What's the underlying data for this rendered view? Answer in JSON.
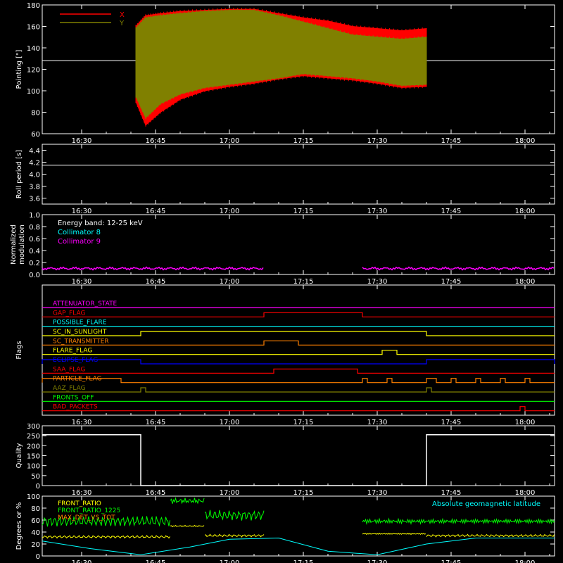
{
  "time_ticks": [
    "16:30",
    "16:45",
    "17:00",
    "17:15",
    "17:30",
    "17:45",
    "18:00"
  ],
  "chart_data": [
    {
      "type": "line",
      "ylabel": "Pointing [\"]",
      "ylim": [
        60,
        180
      ],
      "yticks": [
        60,
        80,
        100,
        120,
        140,
        160,
        180
      ],
      "xlim": [
        "16:22",
        "18:06"
      ],
      "legend": "top-left",
      "series": [
        {
          "name": "X",
          "color": "#ff0000",
          "envelope_time": [
            "16:41",
            "16:43",
            "16:46",
            "16:50",
            "16:55",
            "17:00",
            "17:05",
            "17:10",
            "17:15",
            "17:20",
            "17:25",
            "17:30",
            "17:35",
            "17:40"
          ],
          "upper": [
            160,
            170,
            172,
            174,
            175,
            176,
            176,
            172,
            168,
            165,
            160,
            158,
            156,
            158
          ],
          "lower": [
            90,
            68,
            80,
            92,
            100,
            104,
            107,
            111,
            114,
            112,
            110,
            107,
            103,
            104
          ]
        },
        {
          "name": "Y",
          "color": "#808000",
          "envelope_time": [
            "16:41",
            "16:43",
            "16:46",
            "16:50",
            "16:55",
            "17:00",
            "17:05",
            "17:10",
            "17:15",
            "17:20",
            "17:25",
            "17:30",
            "17:35",
            "17:40"
          ],
          "upper": [
            158,
            168,
            170,
            172,
            174,
            175,
            175,
            170,
            164,
            158,
            152,
            150,
            148,
            150
          ],
          "lower": [
            95,
            75,
            88,
            97,
            103,
            106,
            109,
            112,
            116,
            114,
            112,
            109,
            105,
            106
          ]
        }
      ],
      "reference_line": 128
    },
    {
      "type": "line",
      "ylabel": "Roll period [s]",
      "ylim": [
        3.5,
        4.5
      ],
      "yticks": [
        3.6,
        3.8,
        4.0,
        4.2,
        4.4
      ],
      "series": [
        {
          "color": "#ffffff",
          "value": 4.15
        }
      ]
    },
    {
      "type": "line",
      "ylabel": "Normalized modulation",
      "ylim": [
        0,
        1
      ],
      "yticks": [
        0.0,
        0.2,
        0.4,
        0.6,
        0.8,
        1.0
      ],
      "annotation": "Energy band: 12-25 keV",
      "series": [
        {
          "name": "Collimator 8",
          "color": "#00ffff",
          "segments": []
        },
        {
          "name": "Collimator 9",
          "color": "#ff00ff",
          "segments": [
            [
              "16:22",
              "17:07",
              0.1
            ],
            [
              "17:27",
              "18:06",
              0.1
            ]
          ]
        }
      ]
    },
    {
      "type": "line",
      "ylabel": "Flags",
      "flags": [
        {
          "name": "ATTENUATOR_STATE",
          "color": "#ff00ff",
          "on": []
        },
        {
          "name": "GAP_FLAG",
          "color": "#ff0000",
          "on": [
            [
              "17:07",
              "17:27"
            ]
          ]
        },
        {
          "name": "POSSIBLE_FLARE",
          "color": "#00ffff",
          "on": []
        },
        {
          "name": "SC_IN_SUNLIGHT",
          "color": "#ffff00",
          "on": [
            [
              "16:42",
              "17:40"
            ]
          ]
        },
        {
          "name": "SC_TRANSMITTER",
          "color": "#ff8000",
          "on": [
            [
              "17:07",
              "17:14"
            ]
          ]
        },
        {
          "name": "FLARE_FLAG",
          "color": "#ffff00",
          "on": [
            [
              "17:31",
              "17:34"
            ]
          ]
        },
        {
          "name": "ECLIPSE_FLAG",
          "color": "#0000ff",
          "on": [
            [
              "16:22",
              "16:42"
            ],
            [
              "17:40",
              "18:06"
            ]
          ]
        },
        {
          "name": "SAA_FLAG",
          "color": "#ff0000",
          "on": [
            [
              "17:09",
              "17:26"
            ]
          ]
        },
        {
          "name": "PARTICLE_FLAG",
          "color": "#ff8000",
          "on": [
            [
              "16:22",
              "16:38"
            ],
            [
              "17:27",
              "17:28"
            ],
            [
              "17:32",
              "17:33"
            ],
            [
              "17:40",
              "17:42"
            ],
            [
              "17:45",
              "17:46"
            ],
            [
              "17:50",
              "17:51"
            ],
            [
              "17:55",
              "17:56"
            ],
            [
              "18:00",
              "18:01"
            ]
          ]
        },
        {
          "name": "AAZ_FLAG",
          "color": "#808000",
          "on": [
            [
              "16:42",
              "16:43"
            ],
            [
              "17:40",
              "17:41"
            ]
          ]
        },
        {
          "name": "FRONTS_OFF",
          "color": "#00ff00",
          "on": []
        },
        {
          "name": "BAD_PACKETS",
          "color": "#ff0000",
          "on": [
            [
              "17:59",
              "17:60"
            ]
          ]
        }
      ]
    },
    {
      "type": "line",
      "ylabel": "Quality",
      "ylim": [
        0,
        300
      ],
      "yticks": [
        0,
        50,
        100,
        150,
        200,
        250,
        300
      ],
      "series": [
        {
          "color": "#ffffff",
          "steps": [
            [
              "16:22",
              255
            ],
            [
              "16:42",
              0
            ],
            [
              "17:40",
              255
            ],
            [
              "18:06",
              255
            ]
          ]
        }
      ]
    },
    {
      "type": "line",
      "ylabel": "Degrees or %",
      "ylim": [
        0,
        100
      ],
      "yticks": [
        0,
        20,
        40,
        60,
        80,
        100
      ],
      "legend": "top-left",
      "series": [
        {
          "name": "FRONT_RATIO",
          "color": "#ffff00",
          "segments": [
            [
              "16:22",
              "16:48",
              32
            ],
            [
              "16:48",
              "16:55",
              50
            ],
            [
              "16:55",
              "17:07",
              34
            ],
            [
              "17:27",
              "17:40",
              37
            ],
            [
              "17:40",
              "18:06",
              34
            ]
          ]
        },
        {
          "name": "FRONT_RATIO_1225",
          "color": "#00ff00",
          "segments": [
            [
              "16:22",
              "16:48",
              58
            ],
            [
              "16:48",
              "16:55",
              92
            ],
            [
              "16:55",
              "17:07",
              68
            ],
            [
              "17:27",
              "18:06",
              58
            ]
          ]
        },
        {
          "name": "MAX_DET_VS_TOT",
          "color": "#ff8000",
          "segments": []
        },
        {
          "name": "Absolute geomagnetic latitude",
          "color": "#00ffff",
          "curve_time": [
            "16:22",
            "16:32",
            "16:42",
            "16:52",
            "17:00",
            "17:10",
            "17:20",
            "17:30",
            "17:40",
            "17:50",
            "18:06"
          ],
          "curve_value": [
            25,
            12,
            2,
            15,
            28,
            30,
            8,
            2,
            20,
            30,
            30
          ]
        }
      ]
    }
  ]
}
